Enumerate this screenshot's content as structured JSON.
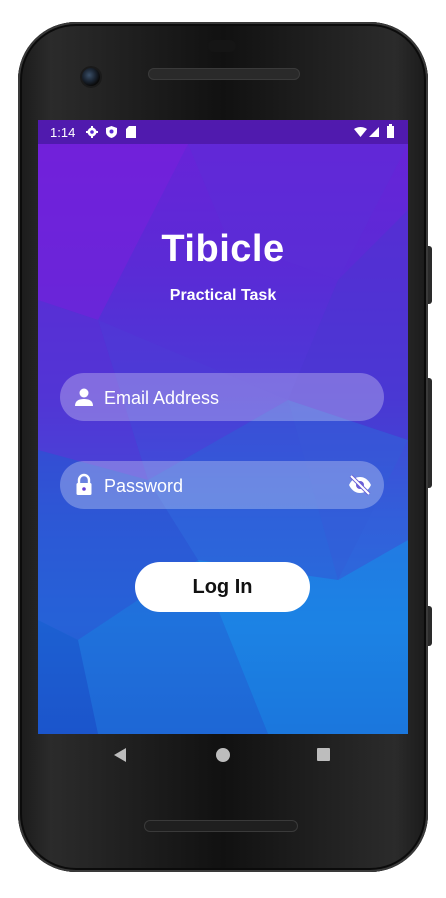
{
  "status_bar": {
    "time": "1:14",
    "left_icons": [
      "settings-icon",
      "shield-icon",
      "sd-card-icon"
    ],
    "right_icons": [
      "wifi-icon",
      "signal-icon",
      "battery-icon"
    ]
  },
  "app": {
    "title": "Tibicle",
    "subtitle": "Practical Task"
  },
  "form": {
    "email": {
      "value": "",
      "placeholder": "Email Address",
      "icon": "person-icon"
    },
    "password": {
      "value": "",
      "placeholder": "Password",
      "icon": "lock-icon",
      "toggle_icon": "eye-off-icon"
    },
    "login_label": "Log In"
  },
  "navigation": {
    "buttons": [
      "back-icon",
      "home-icon",
      "recents-icon"
    ]
  },
  "colors": {
    "gradient_top": "#6a22d8",
    "gradient_bottom": "#1f7ae0",
    "button_bg": "#ffffff",
    "field_bg": "rgba(255,255,255,0.28)"
  }
}
